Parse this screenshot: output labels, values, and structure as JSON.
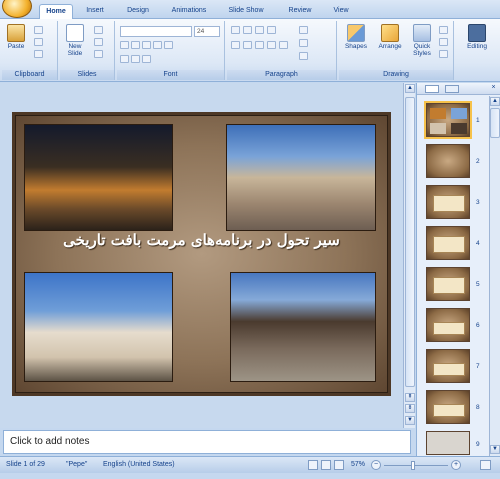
{
  "tabs": [
    {
      "label": "Home",
      "active": true
    },
    {
      "label": "Insert",
      "active": false
    },
    {
      "label": "Design",
      "active": false
    },
    {
      "label": "Animations",
      "active": false
    },
    {
      "label": "Slide Show",
      "active": false
    },
    {
      "label": "Review",
      "active": false
    },
    {
      "label": "View",
      "active": false
    }
  ],
  "ribbon": {
    "clipboard": {
      "label": "Clipboard",
      "paste": "Paste"
    },
    "slides": {
      "label": "Slides",
      "new_slide_1": "New",
      "new_slide_2": "Slide"
    },
    "font": {
      "label": "Font",
      "size_value": "24"
    },
    "paragraph": {
      "label": "Paragraph"
    },
    "drawing": {
      "label": "Drawing",
      "shapes": "Shapes",
      "arrange": "Arrange",
      "quick_styles_1": "Quick",
      "quick_styles_2": "Styles"
    },
    "editing": {
      "label": "Editing"
    }
  },
  "slide": {
    "title": "سیر تحول در برنامه‌های مرمت بافت تاریخی"
  },
  "thumbnails": {
    "tab_icons": [
      "slides-tab-icon",
      "outline-tab-icon"
    ],
    "numbers": [
      "1",
      "2",
      "3",
      "4",
      "5",
      "6",
      "7",
      "8",
      "9"
    ]
  },
  "notes": {
    "placeholder": "Click to add notes"
  },
  "status": {
    "slide_count": "Slide 1 of 29",
    "theme": "\"Pepe\"",
    "language": "English (United States)",
    "zoom": "57%"
  },
  "colors": {
    "accent": "#15428b",
    "slide_frame": "#4d3826"
  }
}
